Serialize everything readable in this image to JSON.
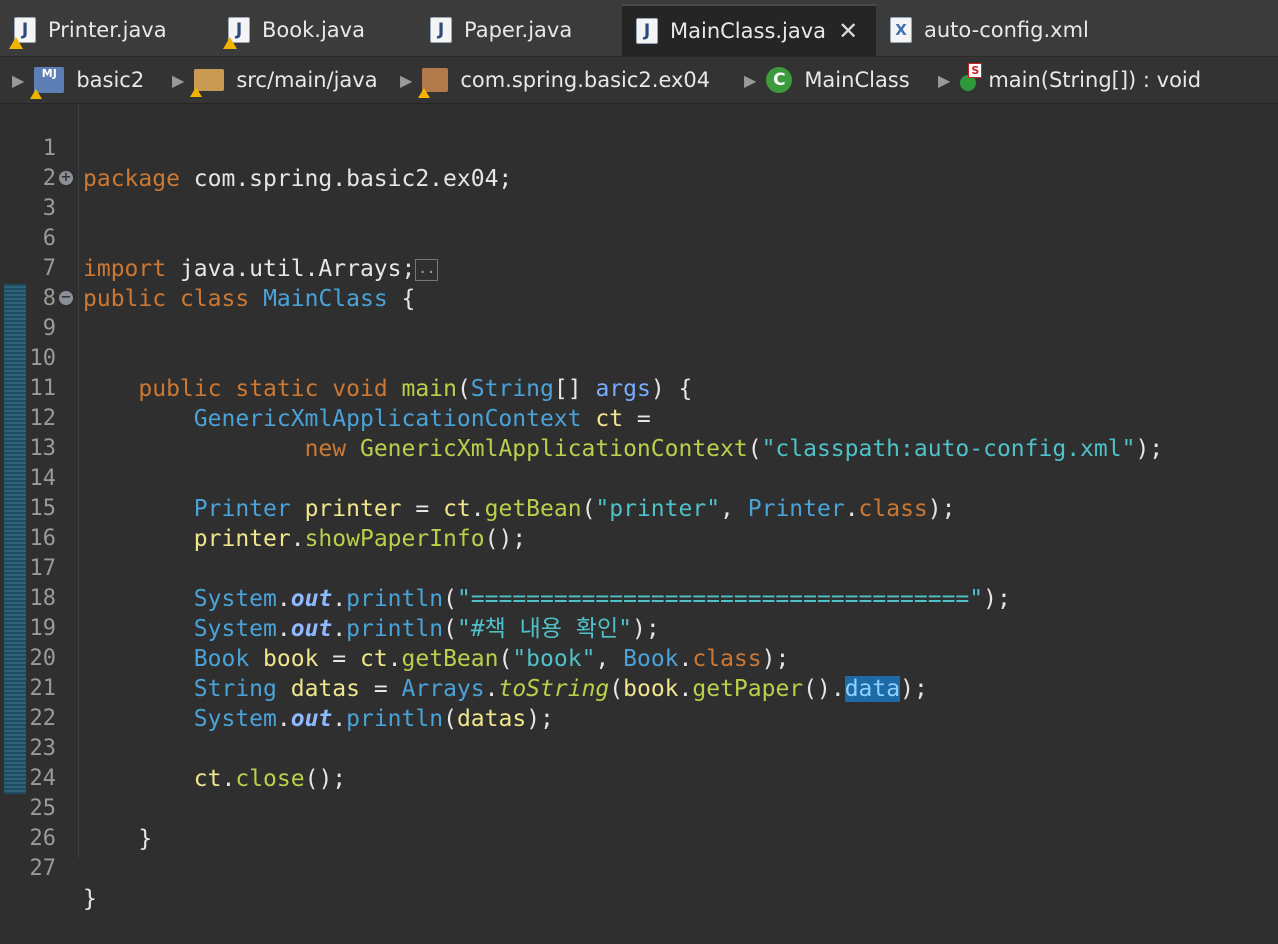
{
  "tabs": [
    {
      "label": "Printer.java",
      "icon": "java-file-icon",
      "warning": true
    },
    {
      "label": "Book.java",
      "icon": "java-file-icon",
      "warning": true
    },
    {
      "label": "Paper.java",
      "icon": "java-file-icon",
      "warning": false
    },
    {
      "label": "MainClass.java",
      "icon": "java-file-icon",
      "warning": false,
      "active": true
    },
    {
      "label": "auto-config.xml",
      "icon": "xml-file-icon",
      "warning": false
    }
  ],
  "breadcrumb": [
    {
      "label": "basic2",
      "icon": "project-icon"
    },
    {
      "label": "src/main/java",
      "icon": "source-folder-icon"
    },
    {
      "label": "com.spring.basic2.ex04",
      "icon": "package-icon"
    },
    {
      "label": "MainClass",
      "icon": "class-icon"
    },
    {
      "label": "main(String[]) : void",
      "icon": "method-icon"
    }
  ],
  "editor": {
    "line_numbers": [
      "1",
      "2",
      "3",
      "6",
      "7",
      "8",
      "9",
      "10",
      "11",
      "12",
      "13",
      "14",
      "15",
      "16",
      "17",
      "18",
      "19",
      "20",
      "21",
      "22",
      "23",
      "24",
      "25",
      "26",
      "27"
    ],
    "tokens": {
      "package_kw": "package",
      "package_name": " com.spring.basic2.ex04;",
      "import_kw": "import",
      "import_name": " java.util.Arrays;",
      "collapsed_marker": "..",
      "public": "public",
      "class": "class",
      "static": "static",
      "void": "void",
      "new": "new",
      "class_name": "MainClass",
      "open_brace": " {",
      "close_brace": "}",
      "main": "main",
      "String": "String",
      "args": "args",
      "GenericXmlApplicationContext": "GenericXmlApplicationContext",
      "ct": "ct",
      "ctx_path": "\"classpath:auto-config.xml\"",
      "Printer": "Printer",
      "printer": "printer",
      "getBean": "getBean",
      "printer_str": "\"printer\"",
      "showPaperInfo": "showPaperInfo",
      "System": "System",
      "out": "out",
      "println": "println",
      "separator_str": "\"====================================\"",
      "korean_str": "\"#책 내용 확인\"",
      "Book": "Book",
      "book": "book",
      "book_str": "\"book\"",
      "datas": "datas",
      "Arrays": "Arrays",
      "toString": "toString",
      "getPaper": "getPaper",
      "data": "data",
      "close": "close"
    }
  }
}
